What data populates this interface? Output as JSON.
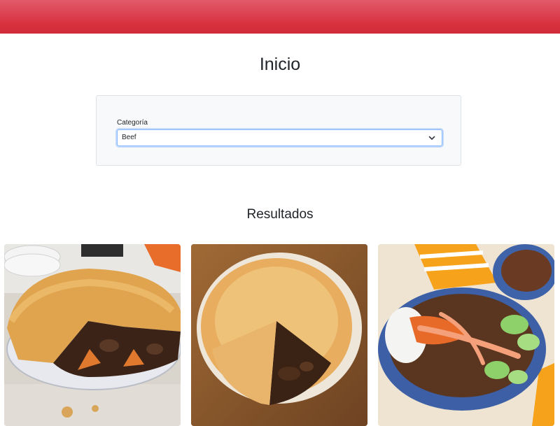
{
  "header": {
    "brand_color": "#dc3545"
  },
  "page": {
    "title": "Inicio"
  },
  "filter": {
    "label": "Categoría",
    "selected": "Beef",
    "icon": "chevron-down-icon"
  },
  "results": {
    "title": "Resultados",
    "items": [
      {
        "image": "steak-pie-photo"
      },
      {
        "image": "beef-pie-photo"
      },
      {
        "image": "beef-rice-bowl-photo"
      }
    ]
  }
}
